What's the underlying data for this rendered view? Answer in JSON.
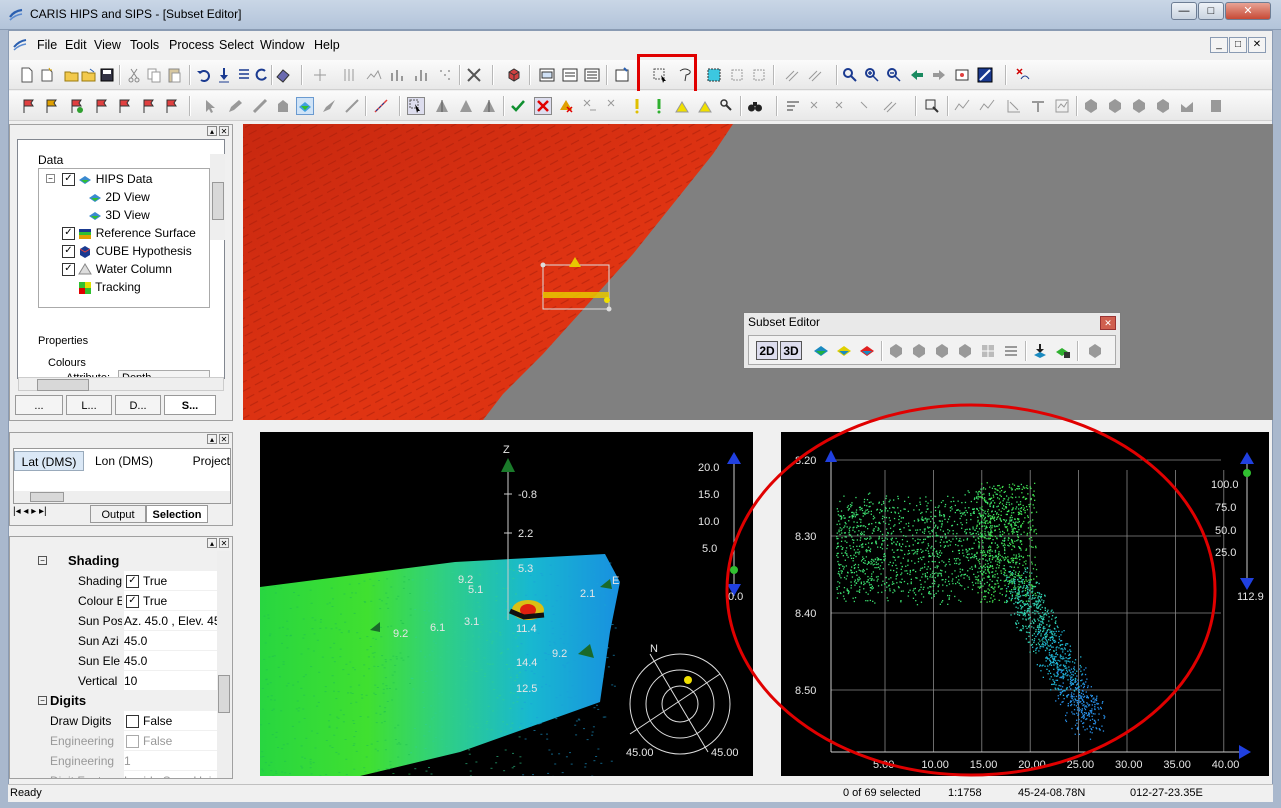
{
  "window": {
    "title": "CARIS HIPS and SIPS - [Subset Editor]",
    "controls": [
      "—",
      "□",
      "✕"
    ]
  },
  "menu": {
    "items": [
      "File",
      "Edit",
      "View",
      "Tools",
      "Process",
      "Select",
      "Window",
      "Help"
    ],
    "mdi_controls": [
      "_",
      "□",
      "✕"
    ]
  },
  "layers_panel": {
    "section_data": "Data",
    "tree": [
      {
        "label": "HIPS Data",
        "checked": true
      },
      {
        "label": "2D View",
        "checked": null
      },
      {
        "label": "3D View",
        "checked": null
      },
      {
        "label": "Reference Surface",
        "checked": true
      },
      {
        "label": "CUBE Hypothesis",
        "checked": true
      },
      {
        "label": "Water Column",
        "checked": true
      },
      {
        "label": "Tracking",
        "checked": null
      }
    ],
    "section_properties": "Properties",
    "colours_label": "Colours",
    "attribute_label": "Attribute:",
    "attribute_value": "Depth",
    "tabs": [
      "...",
      "L...",
      "D...",
      "S..."
    ]
  },
  "output_panel": {
    "columns": [
      "Lat (DMS)",
      "Lon (DMS)",
      "Project"
    ],
    "tabs": [
      "Output",
      "Selection"
    ]
  },
  "properties_panel": {
    "group_shading": "Shading",
    "group_digits": "Digits",
    "rows": [
      {
        "name": "Shading",
        "value": "True",
        "checkbox": true,
        "checked": true,
        "disabled": false
      },
      {
        "name": "Colour E",
        "value": "True",
        "checkbox": true,
        "checked": true,
        "disabled": false
      },
      {
        "name": "Sun Pos",
        "value": "Az. 45.0 , Elev. 45",
        "checkbox": false,
        "disabled": false
      },
      {
        "name": "Sun Azi",
        "value": "45.0",
        "checkbox": false,
        "disabled": false
      },
      {
        "name": "Sun Ele",
        "value": "45.0",
        "checkbox": false,
        "disabled": false
      },
      {
        "name": "Vertical",
        "value": "10",
        "checkbox": false,
        "disabled": false
      }
    ],
    "digit_rows": [
      {
        "name": "Draw Digits",
        "value": "False",
        "checkbox": true,
        "checked": false,
        "disabled": false
      },
      {
        "name": "Engineering",
        "value": "False",
        "checkbox": true,
        "checked": false,
        "disabled": true
      },
      {
        "name": "Engineering",
        "value": "1",
        "checkbox": false,
        "disabled": true
      },
      {
        "name": "Digit Font",
        "value": "Lucida Sans Unicode",
        "checkbox": false,
        "disabled": true
      }
    ]
  },
  "subset_editor": {
    "title": "Subset Editor",
    "btn_2d": "2D",
    "btn_3d": "3D"
  },
  "view3d": {
    "axis_z": "Z",
    "z_labels": [
      "-0.8",
      "2.2",
      "5.3"
    ],
    "scale_labels": [
      "20.0",
      "15.0",
      "10.0",
      "5.0",
      "0.0"
    ],
    "point_labels": [
      "9.2",
      "5.1",
      "2.1",
      "9.2",
      "6.1",
      "3.1",
      "11.4",
      "9.2",
      "14.4",
      "12.5"
    ],
    "compass_n": "N",
    "compass_e": "E",
    "compass_left": "45.00",
    "compass_right": "45.00"
  },
  "profile_view": {
    "y_labels": [
      "8.20",
      "8.30",
      "8.40",
      "8.50"
    ],
    "x_labels": [
      "5.00",
      "10.00",
      "15.00",
      "20.00",
      "25.00",
      "30.00",
      "35.00",
      "40.00"
    ],
    "scale_labels": [
      "100.0",
      "75.0",
      "50.0",
      "25.0",
      "112.9"
    ]
  },
  "status": {
    "ready": "Ready",
    "selected": "0 of 69 selected",
    "scale": "1:1758",
    "lat": "45-24-08.78N",
    "lon": "012-27-23.35E"
  }
}
